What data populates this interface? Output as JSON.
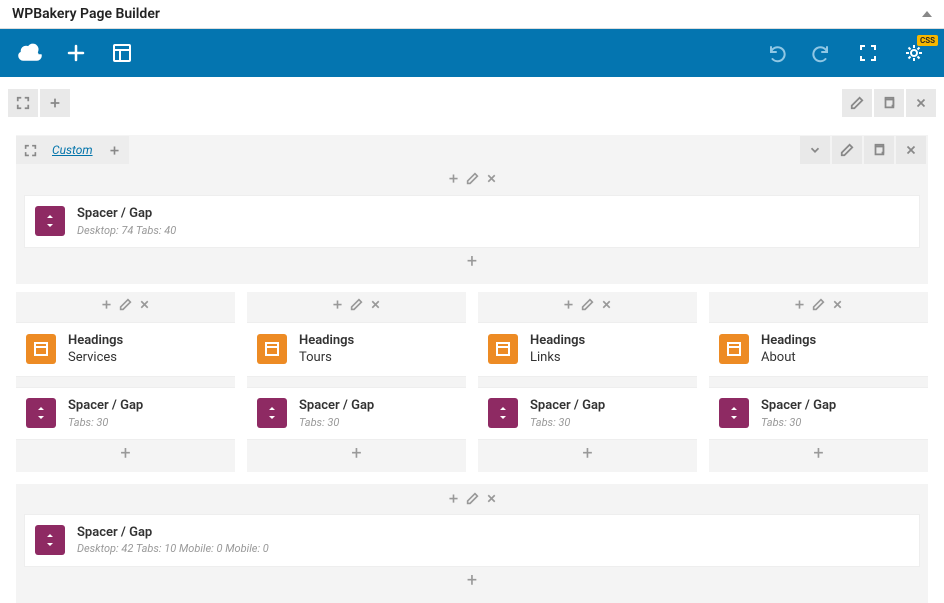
{
  "header": {
    "title": "WPBakery Page Builder"
  },
  "toolbar": {
    "css_badge": "CSS"
  },
  "row1": {
    "label": "Custom",
    "spacer": {
      "title": "Spacer / Gap",
      "sub": "Desktop: 74  Tabs: 40"
    }
  },
  "columns": [
    {
      "heading": {
        "title": "Headings",
        "sub": "Services"
      },
      "spacer": {
        "title": "Spacer / Gap",
        "sub": "Tabs: 30"
      }
    },
    {
      "heading": {
        "title": "Headings",
        "sub": "Tours"
      },
      "spacer": {
        "title": "Spacer / Gap",
        "sub": "Tabs: 30"
      }
    },
    {
      "heading": {
        "title": "Headings",
        "sub": "Links"
      },
      "spacer": {
        "title": "Spacer / Gap",
        "sub": "Tabs: 30"
      }
    },
    {
      "heading": {
        "title": "Headings",
        "sub": "About"
      },
      "spacer": {
        "title": "Spacer / Gap",
        "sub": "Tabs: 30"
      }
    }
  ],
  "row3": {
    "spacer": {
      "title": "Spacer / Gap",
      "sub": "Desktop: 42  Tabs: 10  Mobile: 0  Mobile: 0"
    }
  }
}
